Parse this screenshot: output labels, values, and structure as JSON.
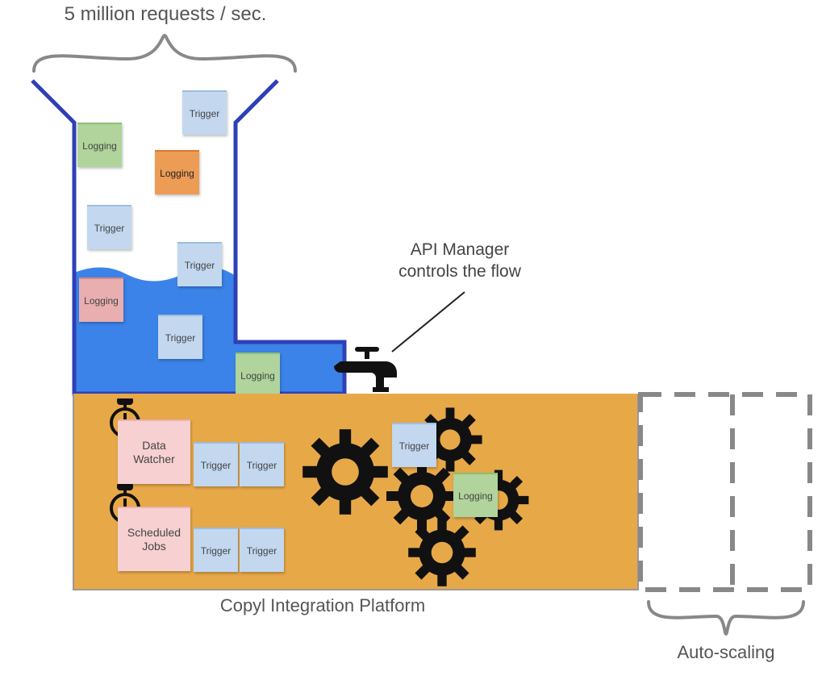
{
  "top_label": "5 million requests / sec.",
  "api_label_line1": "API Manager",
  "api_label_line2": "controls the flow",
  "platform_label": "Copyl Integration Platform",
  "autoscale_label": "Auto-scaling",
  "notes": {
    "funnel": {
      "trigger1": "Trigger",
      "log_green1": "Logging",
      "log_orange": "Logging",
      "trigger2": "Trigger",
      "trigger3": "Trigger",
      "log_pink": "Logging",
      "trigger4": "Trigger",
      "log_green2": "Logging"
    },
    "platform": {
      "data_watcher": "Data\nWatcher",
      "scheduled_jobs": "Scheduled\nJobs",
      "dw_trigger1": "Trigger",
      "dw_trigger2": "Trigger",
      "sj_trigger1": "Trigger",
      "sj_trigger2": "Trigger",
      "gear_trigger": "Trigger",
      "gear_logging": "Logging"
    }
  },
  "colors": {
    "water": "#3b83e8",
    "funnel_stroke": "#2f3fb7",
    "platform_fill": "#e7a848",
    "brace": "#888",
    "dashed": "#888"
  }
}
